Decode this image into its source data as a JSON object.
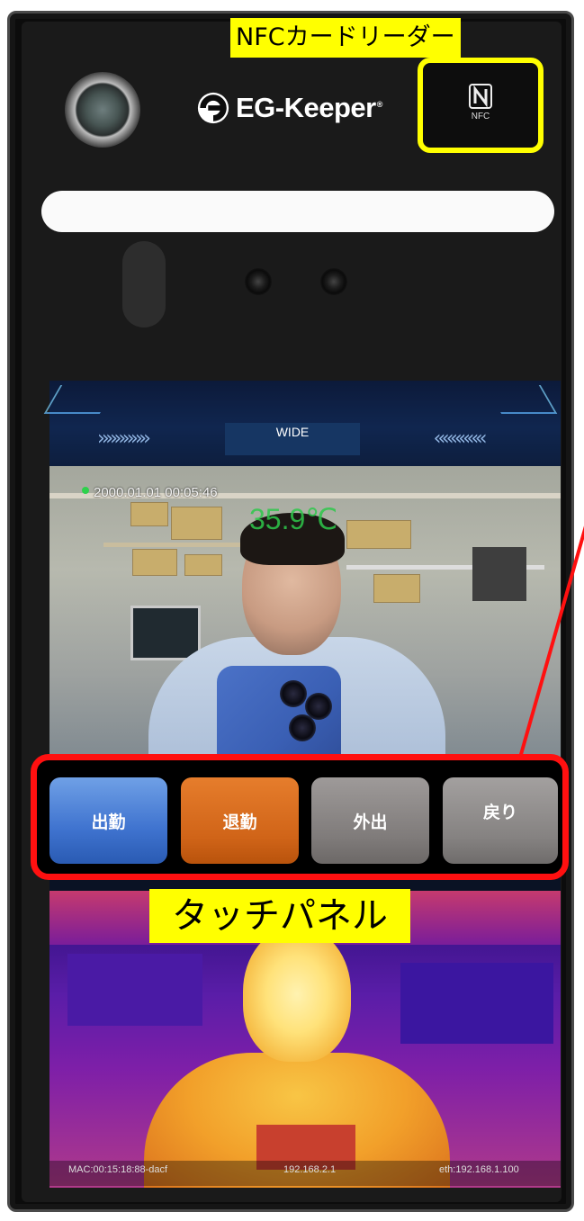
{
  "annotations": {
    "nfc_reader": "NFCカードリーダー",
    "touch_panel": "タッチパネル"
  },
  "device": {
    "brand": "EG-Keeper",
    "brand_mark": "®",
    "nfc_icon_text": "NFC"
  },
  "screen": {
    "mode_label": "WIDE",
    "chevrons_left": "»»»»»»",
    "chevrons_right": "««««««",
    "timestamp": "2000.01.01 00:05:46",
    "temperature": "35.9℃"
  },
  "buttons": [
    {
      "label": "出勤",
      "color": "#3f73cf"
    },
    {
      "label": "退勤",
      "color": "#d06418"
    },
    {
      "label": "外出",
      "color": "#7f7b7a"
    },
    {
      "label": "戻り",
      "color": "#858281"
    }
  ],
  "status_bar": {
    "left": "MAC:00:15:18:88-dacf",
    "middle": "192.168.2.1",
    "right": "eth:192.168.1.100"
  },
  "colors": {
    "highlight_yellow": "#ffff00",
    "frame_red": "#ff1010",
    "temp_green": "#2ec84b"
  }
}
